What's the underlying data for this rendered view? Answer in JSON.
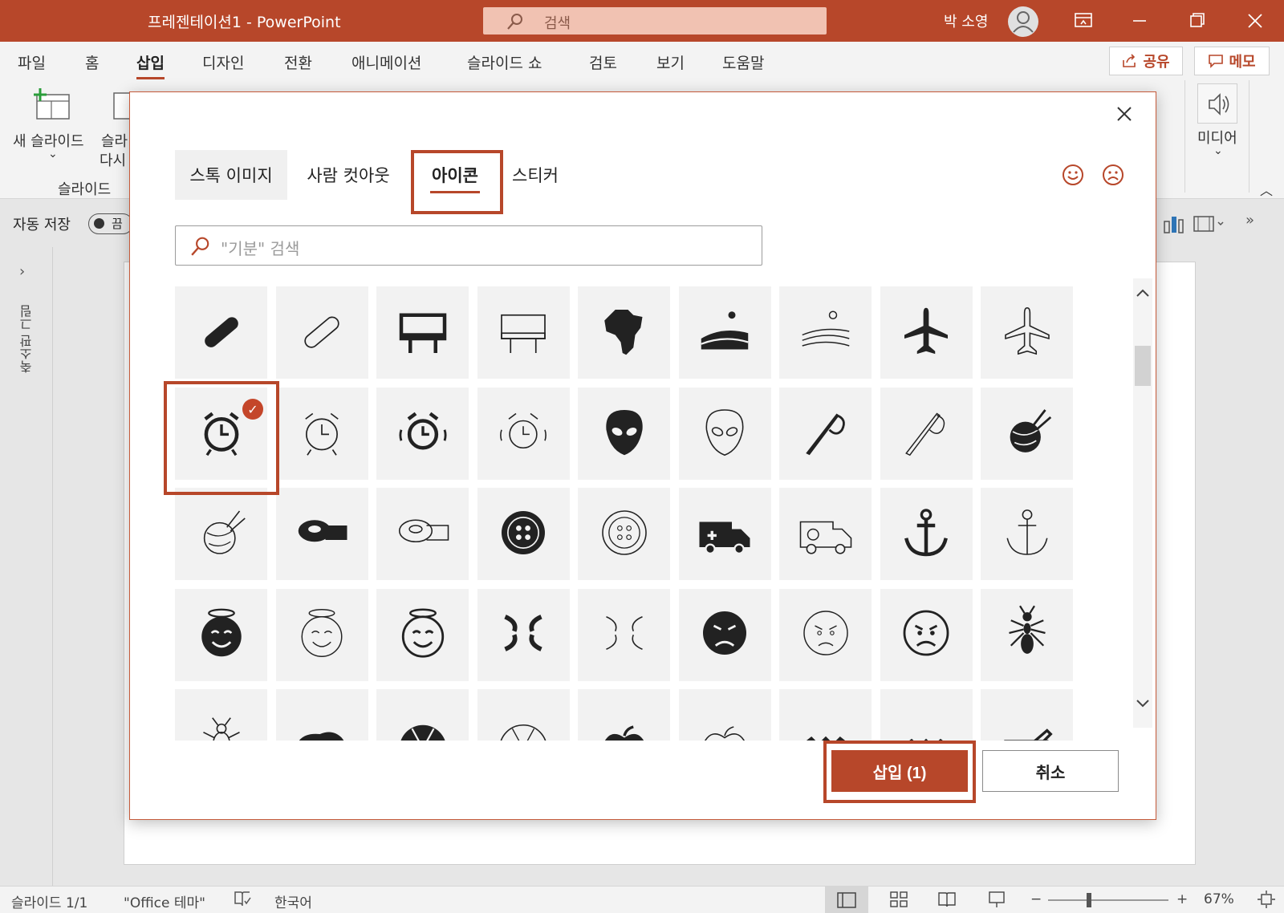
{
  "titlebar": {
    "doc_title": "프레젠테이션1  -  PowerPoint",
    "search_text": "검색",
    "user_name": "박 소영"
  },
  "ribbon_tabs": [
    "파일",
    "홈",
    "삽입",
    "디자인",
    "전환",
    "애니메이션",
    "슬라이드 쇼",
    "검토",
    "보기",
    "도움말"
  ],
  "active_tab": "삽입",
  "share_label": "공유",
  "memo_label": "메모",
  "ribbon": {
    "new_slide_label": "새 슬라이드",
    "reuse_label_top": "슬라",
    "reuse_label_bottom": "다시",
    "group_slides": "슬라이드",
    "media_label": "미디어",
    "autosave_label": "자동 저장",
    "autosave_state": "끔"
  },
  "left_pane": {
    "collapsed_label": "축소판 그림"
  },
  "status": {
    "slide_info": "슬라이드 1/1",
    "theme": "\"Office 테마\"",
    "language": "한국어",
    "zoom": "67%"
  },
  "dialog": {
    "tabs": [
      "스톡 이미지",
      "사람 컷아웃",
      "아이콘",
      "스티커"
    ],
    "active_tab": "아이콘",
    "search_placeholder": "\"기분\" 검색",
    "insert_label": "삽입 (1)",
    "cancel_label": "취소",
    "icons": [
      [
        "bandage-filled-icon",
        "bandage-outline-icon",
        "billboard-filled-icon",
        "billboard-outline-icon",
        "africa-icon",
        "farm-landscape-filled-icon",
        "farm-landscape-outline-icon",
        "airplane-filled-icon",
        "airplane-outline-icon"
      ],
      [
        "alarm-clock-filled-icon",
        "alarm-clock-outline-icon",
        "alarm-ringing-filled-icon",
        "alarm-ringing-outline-icon",
        "alien-filled-icon",
        "alien-outline-icon",
        "needle-thread-filled-icon",
        "needle-thread-outline-icon",
        "yarn-ball-filled-icon"
      ],
      [
        "yarn-ball-outline-icon",
        "measuring-tape-filled-icon",
        "measuring-tape-outline-icon",
        "button-filled-icon",
        "button-outline-icon",
        "ambulance-filled-icon",
        "ambulance-outline-icon",
        "anchor-filled-icon",
        "anchor-outline-icon"
      ],
      [
        "angel-face-filled-icon",
        "angel-face-outline-icon",
        "angel-face-bold-icon",
        "anger-symbol-filled-icon",
        "anger-symbol-outline-icon",
        "angry-face-filled-icon",
        "angry-face-outline-icon",
        "angry-face-bold-icon",
        "ant-icon"
      ],
      [
        "bug-outline-icon",
        "anteater-icon",
        "aperture-filled-icon",
        "aperture-outline-icon",
        "apple-filled-icon",
        "apple-outline-icon",
        "zigzag-filled-icon",
        "zigzag-outline-icon",
        "signpost-icon"
      ]
    ],
    "selected_icon": "alarm-clock-filled-icon",
    "accent_color": "#b7472a"
  }
}
